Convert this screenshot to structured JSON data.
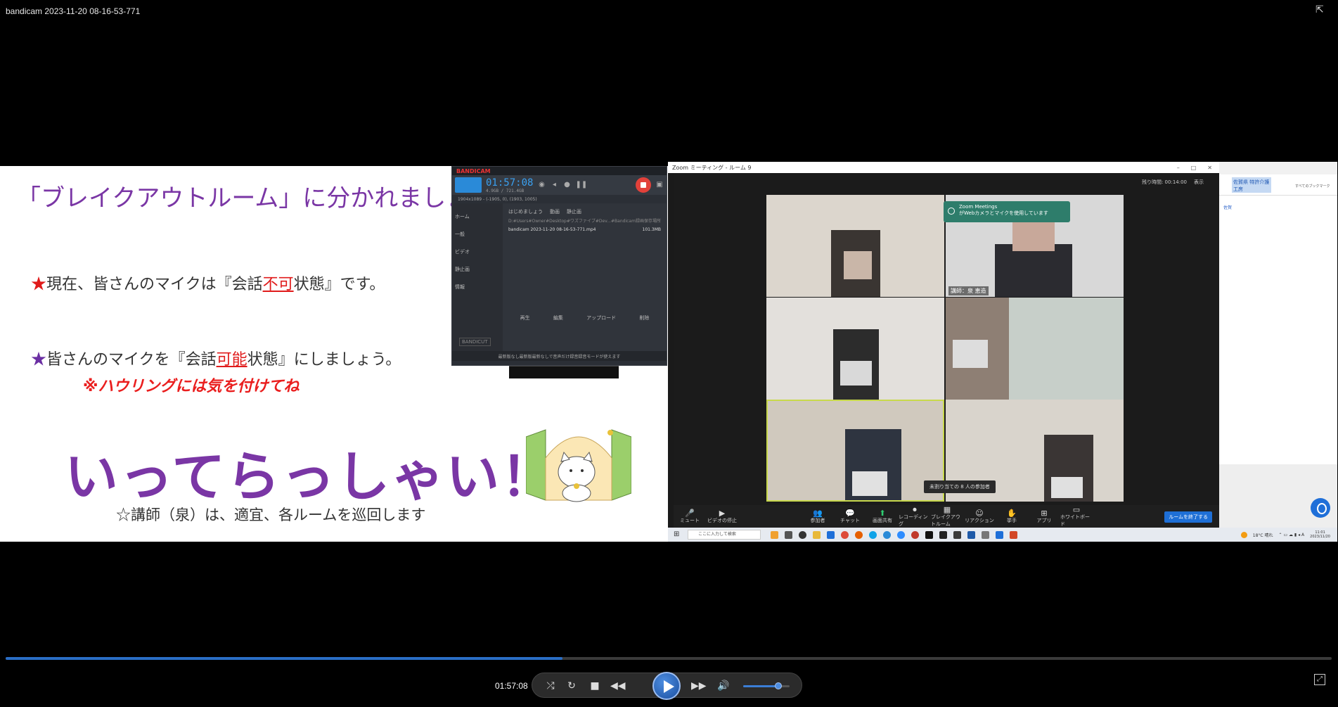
{
  "window": {
    "title": "bandicam 2023-11-20 08-16-53-771"
  },
  "slide": {
    "title": "「ブレイクアウトルーム」に分かれましょう",
    "bullet1": {
      "star": "★",
      "pre": "現在、皆さんのマイクは『会話",
      "em": "不可",
      "post": "状態』です。"
    },
    "bullet2": {
      "star": "★",
      "pre": "皆さんのマイクを『会話",
      "em": "可能",
      "post": "状態』にしましょう。"
    },
    "warning": "※ハウリングには気を付けてね",
    "big": "いってらっしゃい！",
    "note": "☆講師（泉）は、適宜、各ルームを巡回します"
  },
  "bandicam": {
    "brand": "BANDICAM",
    "time": "01:57:08",
    "size": "4.9GB / 721.4GB",
    "resolution": "1904x1089 - (-1905, 0), (1903, 1005)",
    "sidebar": [
      "ホーム",
      "一般",
      "ビデオ",
      "静止画",
      "情報"
    ],
    "tabs": [
      "はじめましょう",
      "動画",
      "静止画"
    ],
    "path": "D:#Users#Owner#Desktop#ワズファイブ#Dev...#Bandicam録画保存場所",
    "file": {
      "name": "bandicam 2023-11-20 08-16-53-771.mp4",
      "size": "101.3MB"
    },
    "actions": [
      "再生",
      "編集",
      "アップロード",
      "削除"
    ],
    "cut": "BANDICUT",
    "footer": "最新版なし最新版最新なしで音声だけ録音録音モードが使えます"
  },
  "zoom": {
    "title": "Zoom ミーティング - ルーム 9",
    "view_label": "表示",
    "elapsed": "残り時間: 00:14:00",
    "toast": {
      "title": "Zoom Meetings",
      "text": "がWebカメラとマイクを使用しています"
    },
    "speaker_label": "講師：泉 恵造",
    "tooltip": "未割り当ての 8 人の参加者",
    "toolbar": [
      {
        "icon": "🎤",
        "label": "ミュート"
      },
      {
        "icon": "▶",
        "label": "ビデオの停止"
      },
      {
        "icon": "👥",
        "label": "参加者"
      },
      {
        "icon": "💬",
        "label": "チャット"
      },
      {
        "icon": "⬆",
        "label": "画面共有"
      },
      {
        "icon": "⏺",
        "label": "レコーディング"
      },
      {
        "icon": "▦",
        "label": "ブレイクアウトルーム"
      },
      {
        "icon": "☺",
        "label": "リアクション"
      },
      {
        "icon": "✋",
        "label": "挙手"
      },
      {
        "icon": "⊞",
        "label": "アプリ"
      },
      {
        "icon": "▭",
        "label": "ホワイトボード"
      }
    ],
    "close_rooms": "ルームを終了する"
  },
  "browser_strip": {
    "tag": "佐賀県 特許介護工房",
    "bookmarks": "すべてのブックマーク",
    "link": "佐賀"
  },
  "taskbar": {
    "search_placeholder": "ここに入力して検索",
    "weather": "18°C 晴れ",
    "clock_time": "11:01",
    "clock_date": "2023/11/20"
  },
  "player": {
    "current_time": "01:57:08",
    "progress": 0.42,
    "volume": 0.75
  },
  "colors": {
    "accent": "#2a6ec6",
    "slide_purple": "#7a36a5",
    "slide_red": "#e01b1b"
  }
}
